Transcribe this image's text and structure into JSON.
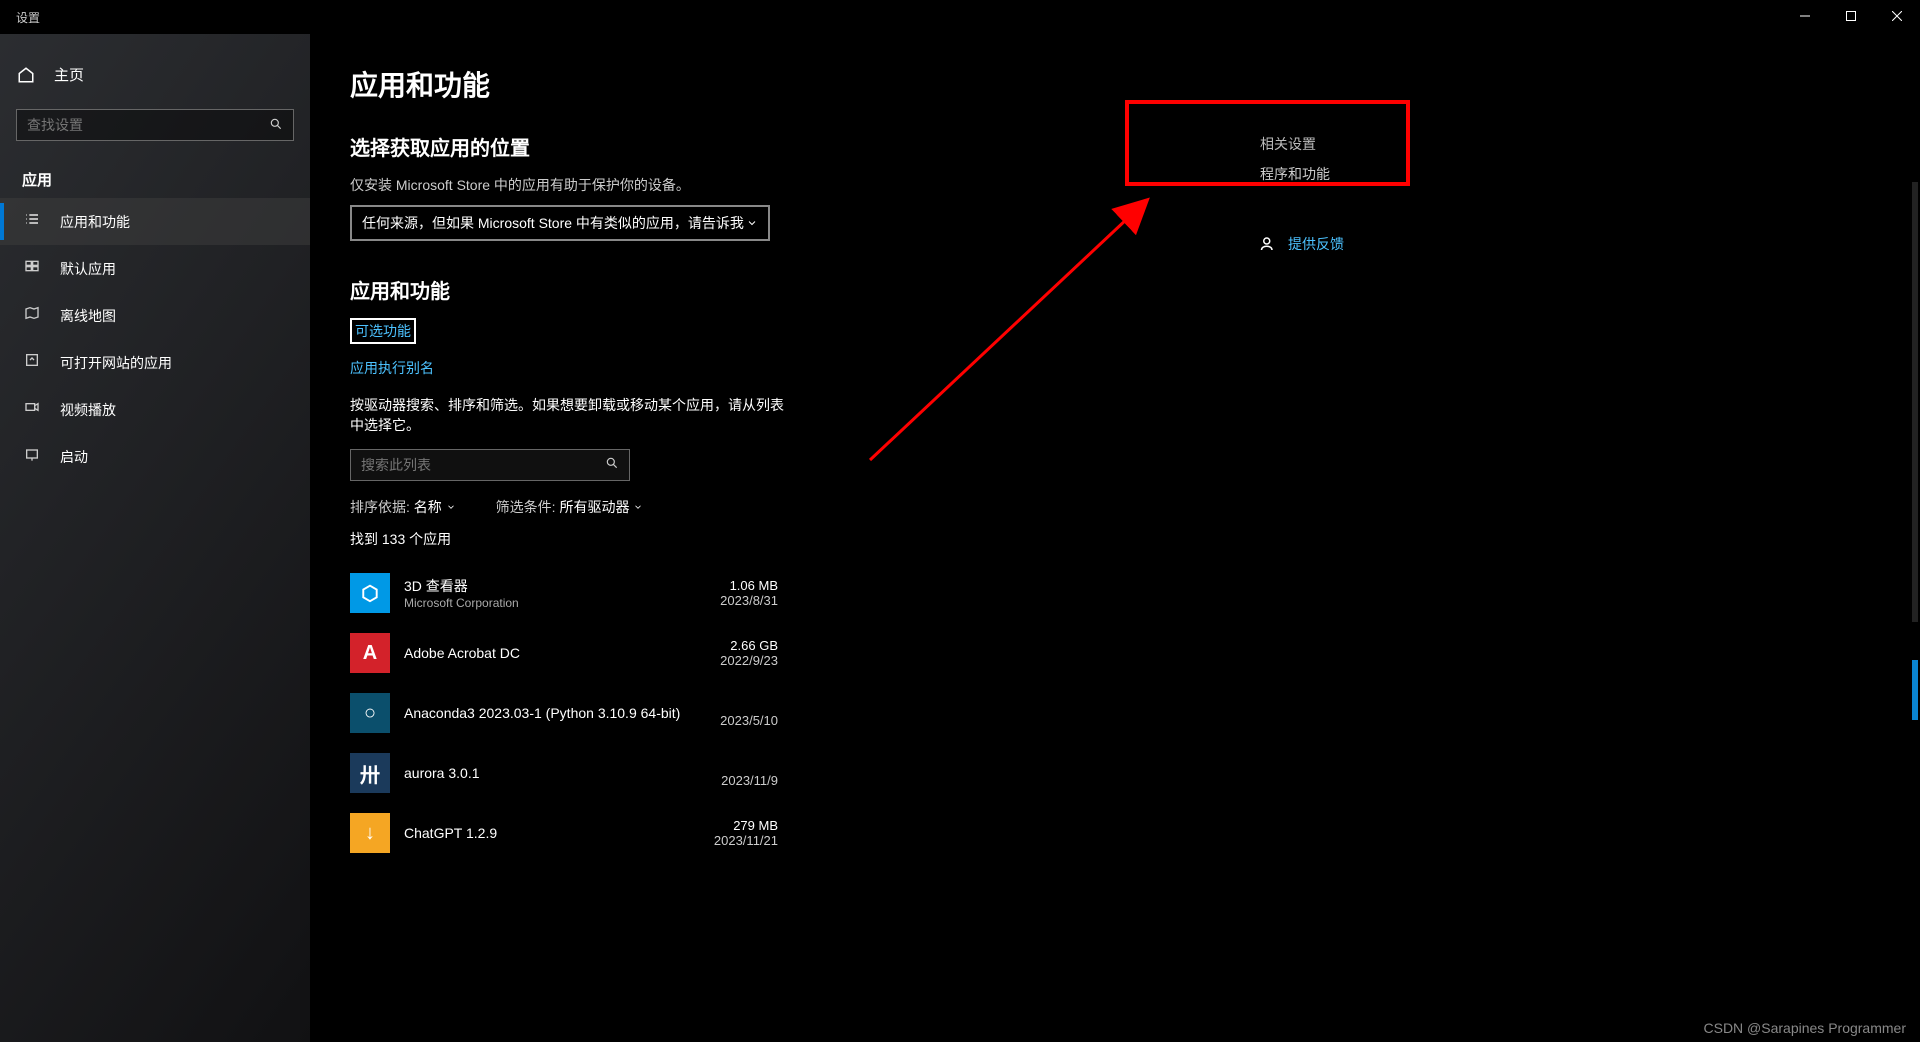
{
  "window": {
    "title": "设置"
  },
  "sidebar": {
    "home": "主页",
    "search_placeholder": "查找设置",
    "category": "应用",
    "items": [
      {
        "label": "应用和功能",
        "selected": true
      },
      {
        "label": "默认应用",
        "selected": false
      },
      {
        "label": "离线地图",
        "selected": false
      },
      {
        "label": "可打开网站的应用",
        "selected": false
      },
      {
        "label": "视频播放",
        "selected": false
      },
      {
        "label": "启动",
        "selected": false
      }
    ]
  },
  "content": {
    "title": "应用和功能",
    "section_source": "选择获取应用的位置",
    "source_helper": "仅安装 Microsoft Store 中的应用有助于保护你的设备。",
    "source_value": "任何来源，但如果 Microsoft Store 中有类似的应用，请告诉我",
    "section_apps": "应用和功能",
    "link_optional": "可选功能",
    "link_alias": "应用执行别名",
    "instructions": "按驱动器搜索、排序和筛选。如果想要卸载或移动某个应用，请从列表中选择它。",
    "filter_placeholder": "搜索此列表",
    "sort_label": "排序依据:",
    "sort_value": "名称",
    "filter_label": "筛选条件:",
    "filter_value": "所有驱动器",
    "count": "找到 133 个应用"
  },
  "apps": [
    {
      "name": "3D 查看器",
      "publisher": "Microsoft Corporation",
      "size": "1.06 MB",
      "date": "2023/8/31",
      "color": "#0099e6",
      "glyph": "⬡"
    },
    {
      "name": "Adobe Acrobat DC",
      "publisher": "",
      "size": "2.66 GB",
      "date": "2022/9/23",
      "color": "#d3222a",
      "glyph": "A"
    },
    {
      "name": "Anaconda3 2023.03-1 (Python 3.10.9 64-bit)",
      "publisher": "",
      "size": "",
      "date": "2023/5/10",
      "color": "#0b4f6c",
      "glyph": "○"
    },
    {
      "name": "aurora 3.0.1",
      "publisher": "",
      "size": "",
      "date": "2023/11/9",
      "color": "#1b3a5b",
      "glyph": "卅"
    },
    {
      "name": "ChatGPT 1.2.9",
      "publisher": "",
      "size": "279 MB",
      "date": "2023/11/21",
      "color": "#f5a623",
      "glyph": "↓"
    }
  ],
  "right": {
    "header": "相关设置",
    "programs": "程序和功能",
    "feedback": "提供反馈"
  },
  "watermark": "CSDN @Sarapines Programmer"
}
